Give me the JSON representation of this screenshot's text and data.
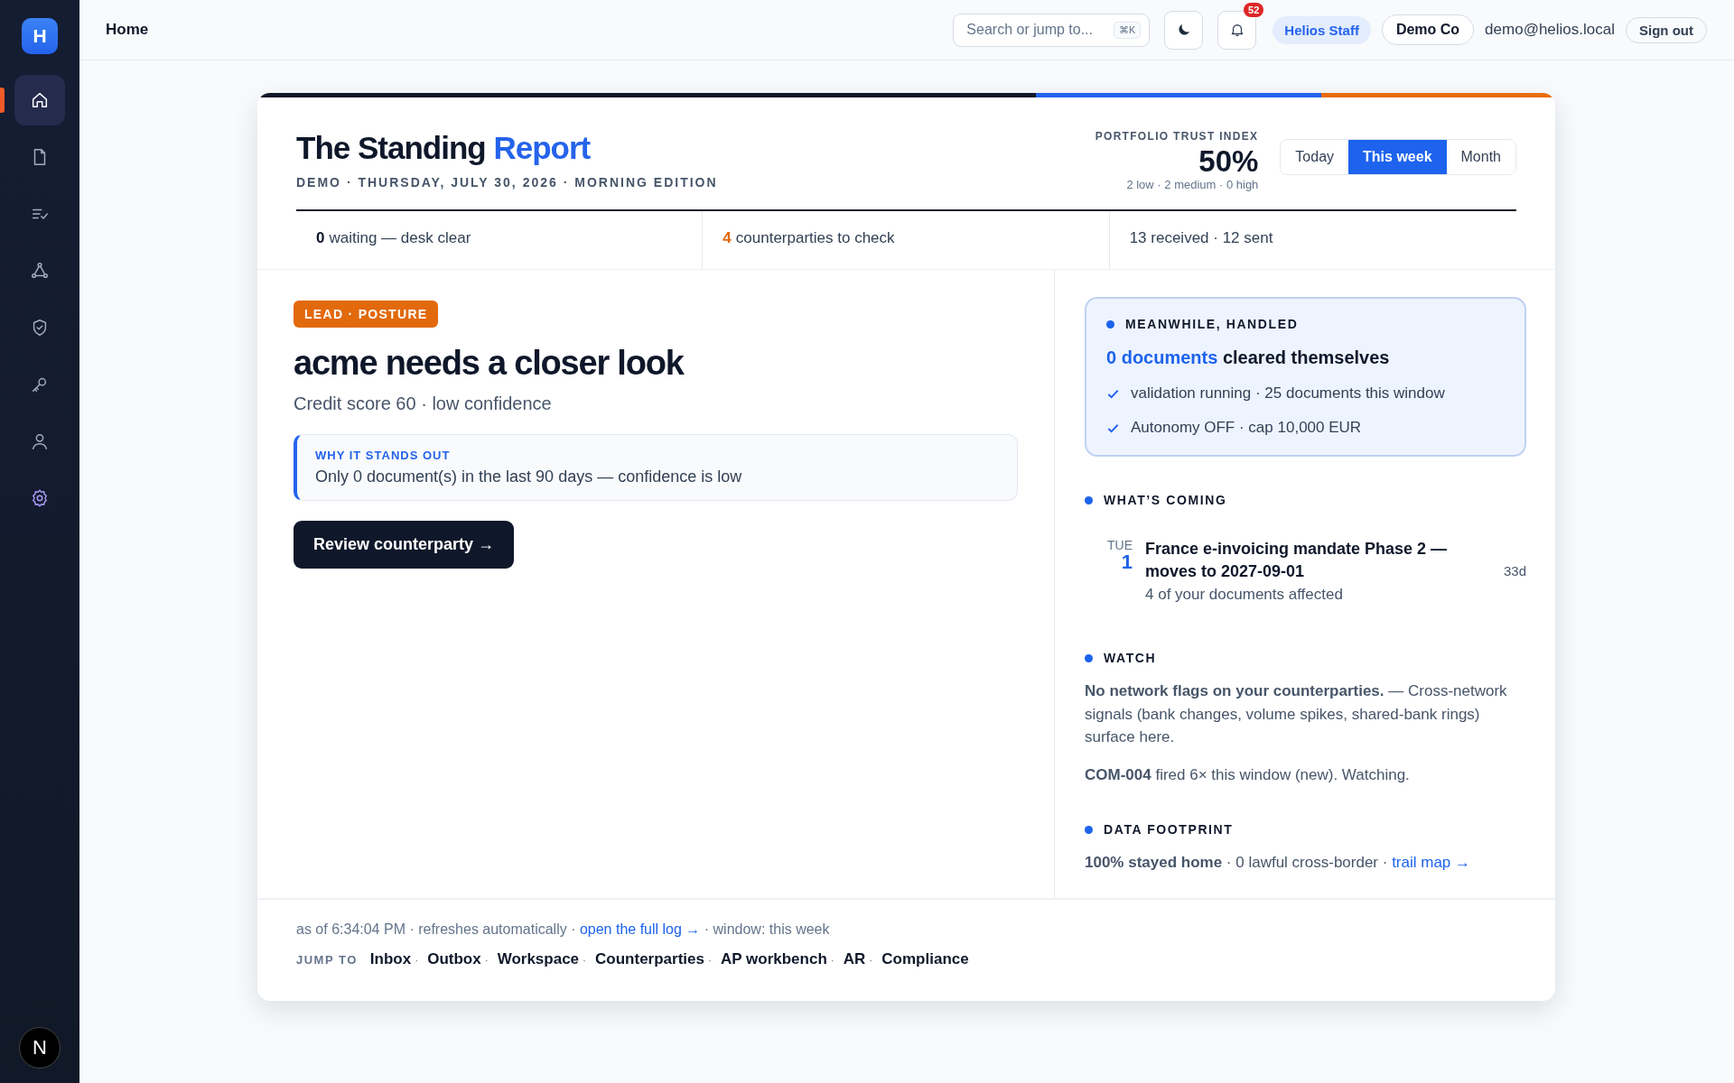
{
  "sidebar": {
    "logo": "H",
    "items": [
      {
        "selected": true
      },
      {
        "selected": false
      },
      {
        "selected": false
      },
      {
        "selected": false
      },
      {
        "selected": false
      },
      {
        "selected": false
      },
      {
        "selected": false
      },
      {
        "selected": false
      }
    ],
    "avatar": "N"
  },
  "topbar": {
    "title": "Home",
    "search": {
      "placeholder": "Search or jump to...",
      "shortcut": "⌘K"
    },
    "notifications": "52",
    "role": "Helios Staff",
    "org": "Demo Co",
    "email": "demo@helios.local",
    "sign_out": "Sign out"
  },
  "report": {
    "title": "The Standing",
    "title_accent": "Report",
    "edition": "DEMO · THURSDAY, JULY 30, 2026 · MORNING EDITION",
    "index": {
      "label": "PORTFOLIO TRUST INDEX",
      "value": "50%",
      "breakdown": "2 low · 2 medium · 0 high"
    },
    "periods": [
      {
        "label": "Today",
        "selected": false
      },
      {
        "label": "This week",
        "selected": true
      },
      {
        "label": "Month",
        "selected": false
      }
    ],
    "stats": [
      {
        "value": "0",
        "label": "waiting — desk clear",
        "color": "#0f172a"
      },
      {
        "value": "4",
        "label": "counterparties to check",
        "color": "#e2690c"
      },
      {
        "label": "13 received · 12 sent"
      }
    ],
    "lead": {
      "badge": "LEAD · POSTURE",
      "headline": "acme needs a closer look",
      "subtitle": "Credit score 60 · low confidence",
      "why_label": "WHY IT STANDS OUT",
      "why_text": "Only 0 document(s) in the last 90 days — confidence is low",
      "action": "Review counterparty →"
    },
    "handled": {
      "heading": "MEANWHILE, HANDLED",
      "link": "0 documents",
      "text": "cleared themselves",
      "checks": [
        "validation running · 25 documents this window",
        "Autonomy OFF · cap 10,000 EUR"
      ]
    },
    "coming": {
      "heading": "WHAT’S COMING",
      "events": [
        {
          "weekday": "TUE",
          "day": "1",
          "title": "France e-invoicing mandate Phase 2 — moves to 2027-09-01",
          "detail": "4 of your documents affected",
          "countdown": "33d"
        }
      ]
    },
    "watch": {
      "heading": "WATCH",
      "paragraphs": [
        "**No network flags on your counterparties.** — Cross-network signals (bank changes, volume spikes, shared-bank rings) surface here.",
        "**COM-004** fired 6× this window (new). Watching."
      ]
    },
    "footprint": {
      "heading": "DATA FOOTPRINT",
      "text": "**100% stayed home** · 0 lawful cross-border · ",
      "link": "trail map →"
    },
    "footer": {
      "status_before": "as of 6:34:04 PM · refreshes automatically · ",
      "status_link": "open the full log →",
      "status_after": " · window: this week",
      "jump_label": "JUMP TO",
      "separator": "·",
      "links": [
        "Inbox",
        "Outbox",
        "Workspace",
        "Counterparties",
        "AP workbench",
        "AR",
        "Compliance"
      ]
    }
  }
}
